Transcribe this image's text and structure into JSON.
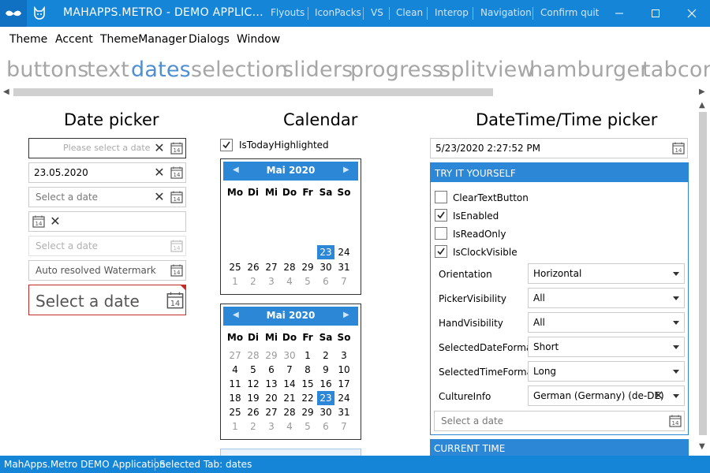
{
  "titlebar": {
    "title": "MAHAPPS.METRO - DEMO APPLIC...",
    "commands": [
      "Flyouts",
      "IconPacks",
      "VS",
      "Clean",
      "Interop",
      "Navigation",
      "Confirm quit"
    ]
  },
  "menu": [
    "Theme",
    "Accent",
    "ThemeManager",
    "Dialogs",
    "Window"
  ],
  "tabs": {
    "items": [
      "buttons",
      "text",
      "dates",
      "selection",
      "sliders",
      "progress",
      "splitview",
      "hamburger",
      "tabcont"
    ],
    "selected": "dates"
  },
  "datepicker": {
    "heading": "Date picker",
    "fields": [
      {
        "text": "Please select a date",
        "clear": "✕"
      },
      {
        "text": "23.05.2020",
        "clear": "✕"
      },
      {
        "text": "Select a date",
        "clear": "✕"
      },
      {
        "text": "",
        "clear": "✕"
      },
      {
        "text": "Select a date",
        "clear": ""
      },
      {
        "text": "Auto resolved Watermark",
        "clear": ""
      },
      {
        "text": "Select a date",
        "clear": ""
      }
    ]
  },
  "calendar": {
    "heading": "Calendar",
    "checkbox_label": "IsTodayHighlighted",
    "checkbox_checked": true,
    "month_title": "Mai 2020",
    "weekdays": [
      "Mo",
      "Di",
      "Mi",
      "Do",
      "Fr",
      "Sa",
      "So"
    ],
    "cal1_rows": [
      [
        "",
        "",
        "",
        "",
        "",
        "23",
        "24"
      ],
      [
        "25",
        "26",
        "27",
        "28",
        "29",
        "30",
        "31"
      ],
      [
        "1",
        "2",
        "3",
        "4",
        "5",
        "6",
        "7"
      ]
    ],
    "cal2_rows": [
      [
        "27",
        "28",
        "29",
        "30",
        "1",
        "2",
        "3"
      ],
      [
        "4",
        "5",
        "6",
        "7",
        "8",
        "9",
        "10"
      ],
      [
        "11",
        "12",
        "13",
        "14",
        "15",
        "16",
        "17"
      ],
      [
        "18",
        "19",
        "20",
        "21",
        "22",
        "23",
        "24"
      ],
      [
        "25",
        "26",
        "27",
        "28",
        "29",
        "30",
        "31"
      ],
      [
        "1",
        "2",
        "3",
        "4",
        "5",
        "6",
        "7"
      ]
    ],
    "today": "23"
  },
  "datetime": {
    "heading": "DateTime/Time picker",
    "value": "5/23/2020 2:27:52 PM",
    "group_title": "TRY IT YOURSELF",
    "checkboxes": [
      {
        "label": "ClearTextButton",
        "checked": false
      },
      {
        "label": "IsEnabled",
        "checked": true
      },
      {
        "label": "IsReadOnly",
        "checked": false
      },
      {
        "label": "IsClockVisible",
        "checked": true
      }
    ],
    "properties": [
      {
        "label": "Orientation",
        "value": "Horizontal"
      },
      {
        "label": "PickerVisibility",
        "value": "All"
      },
      {
        "label": "HandVisibility",
        "value": "All"
      },
      {
        "label": "SelectedDateFormat",
        "value": "Short"
      },
      {
        "label": "SelectedTimeFormat",
        "value": "Long"
      },
      {
        "label": "CultureInfo",
        "value": "German (Germany) (de-DE)"
      }
    ],
    "culture_clear": "✕",
    "date_input_placeholder": "Select a date",
    "group2_title": "CURRENT TIME"
  },
  "statusbar": {
    "app_name": "MahApps.Metro DEMO Application",
    "selected_tab": "Selected Tab:  dates"
  },
  "colors": {
    "accent": "#1585d8",
    "calendar_accent": "#2c88d6",
    "selected_tab": "#4f8fd1",
    "inactive_tab": "#a6a6a6",
    "error_border": "#c42b2b"
  }
}
